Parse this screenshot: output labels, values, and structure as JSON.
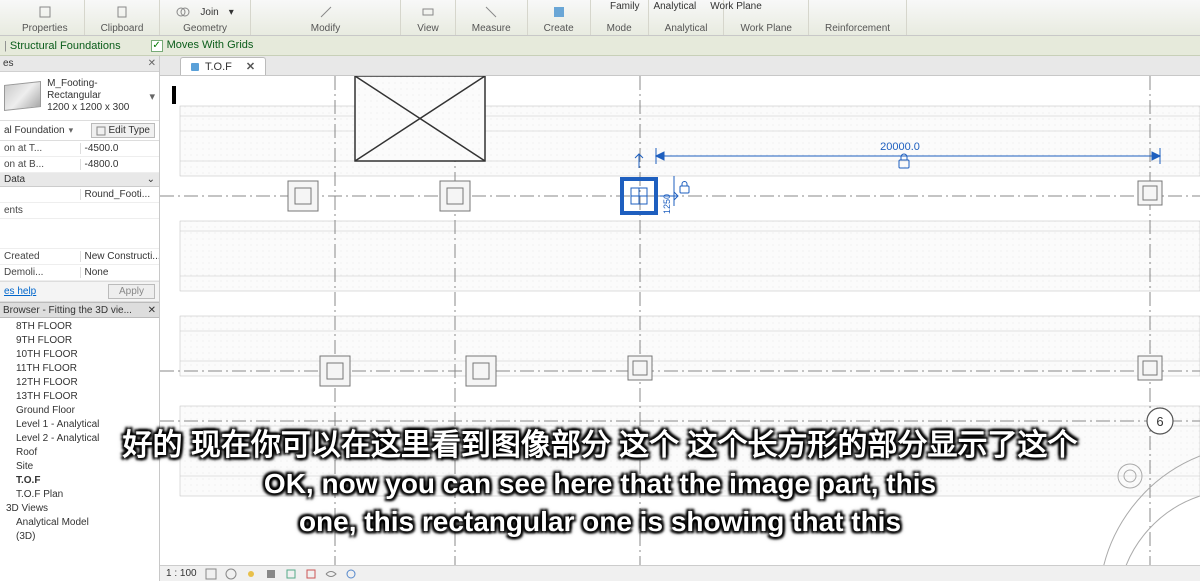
{
  "ribbon": {
    "groups": [
      {
        "label": "Properties"
      },
      {
        "label": "Clipboard"
      },
      {
        "label": "Geometry",
        "join": "Join"
      },
      {
        "label": "Modify"
      },
      {
        "label": "View"
      },
      {
        "label": "Measure"
      },
      {
        "label": "Create"
      },
      {
        "label": "Mode"
      },
      {
        "label": "Analytical"
      },
      {
        "label": "Work Plane"
      },
      {
        "label": "Reinforcement"
      }
    ],
    "row2": [
      "Family",
      "Analytical",
      "Work Plane"
    ]
  },
  "optionsbar": {
    "context": "Structural Foundations",
    "moves_with_grids": "Moves With Grids",
    "checked": true
  },
  "properties": {
    "panel_title": "es",
    "type_name": "M_Footing-Rectangular",
    "type_size": "1200 x 1200 x 300",
    "category": "al Foundation",
    "edit_type": "Edit Type",
    "constraints": [
      {
        "l": "on at T...",
        "v": "-4500.0"
      },
      {
        "l": "on at B...",
        "v": "-4800.0"
      }
    ],
    "data_hdr": "Data",
    "data_rows": [
      {
        "l": "",
        "v": "Round_Footi..."
      }
    ],
    "ents": "ents",
    "phase": [
      {
        "l": "Created",
        "v": "New Constructi..."
      },
      {
        "l": "Demoli...",
        "v": "None"
      }
    ],
    "help": "es help",
    "apply": "Apply"
  },
  "browser": {
    "title": "Browser - Fitting the 3D vie...",
    "items": [
      "8TH FLOOR",
      "9TH FLOOR",
      "10TH FLOOR",
      "11TH FLOOR",
      "12TH FLOOR",
      "13TH FLOOR",
      "Ground Floor",
      "Level 1 - Analytical",
      "Level 2 - Analytical",
      "Roof",
      "Site",
      "T.O.F",
      "T.O.F Plan"
    ],
    "hdr2": "3D Views",
    "items2": [
      "Analytical Model",
      "(3D)"
    ],
    "selected": "T.O.F"
  },
  "viewtab": {
    "name": "T.O.F"
  },
  "drawing": {
    "dim_label": "20000.0",
    "dim_small": "1250",
    "grid_bubble": "6"
  },
  "status": {
    "scale": "1 : 100"
  },
  "subtitles": {
    "cn": "好的 现在你可以在这里看到图像部分 这个 这个长方形的部分显示了这个",
    "en1": "OK, now you can see here that the image part, this",
    "en2": "one, this rectangular one is showing that this"
  }
}
